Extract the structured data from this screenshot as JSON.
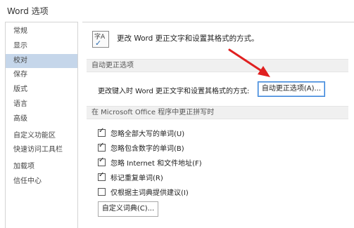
{
  "window": {
    "title": "Word 选项"
  },
  "sidebar": {
    "items": [
      {
        "label": "常规"
      },
      {
        "label": "显示"
      },
      {
        "label": "校对",
        "selected": true
      },
      {
        "label": "保存"
      },
      {
        "label": "版式"
      },
      {
        "label": "语言"
      },
      {
        "label": "高级"
      },
      {
        "label": "自定义功能区"
      },
      {
        "label": "快速访问工具栏"
      },
      {
        "label": "加载项"
      },
      {
        "label": "信任中心"
      }
    ]
  },
  "main": {
    "header_text": "更改 Word 更正文字和设置其格式的方式。",
    "header_icon": {
      "name": "spelling-abc-check-icon",
      "glyph": "字A"
    },
    "autocorrect_section": {
      "title": "自动更正选项",
      "row_label": "更改键入时 Word 更正文字和设置其格式的方式:",
      "button_label": "自动更正选项(A)..."
    },
    "spelling_section": {
      "title": "在 Microsoft Office 程序中更正拼写时",
      "options": [
        {
          "label": "忽略全部大写的单词(U)",
          "checked": true
        },
        {
          "label": "忽略包含数字的单词(B)",
          "checked": true
        },
        {
          "label": "忽略 Internet 和文件地址(F)",
          "checked": true
        },
        {
          "label": "标记重复单词(R)",
          "checked": true
        },
        {
          "label": "仅根据主词典提供建议(I)",
          "checked": false
        }
      ],
      "custom_dict_button": "自定义词典(C)..."
    }
  },
  "colors": {
    "selected_bg": "#c5d6ea",
    "arrow": "#e02020",
    "focus_border": "#2f7ed8"
  }
}
